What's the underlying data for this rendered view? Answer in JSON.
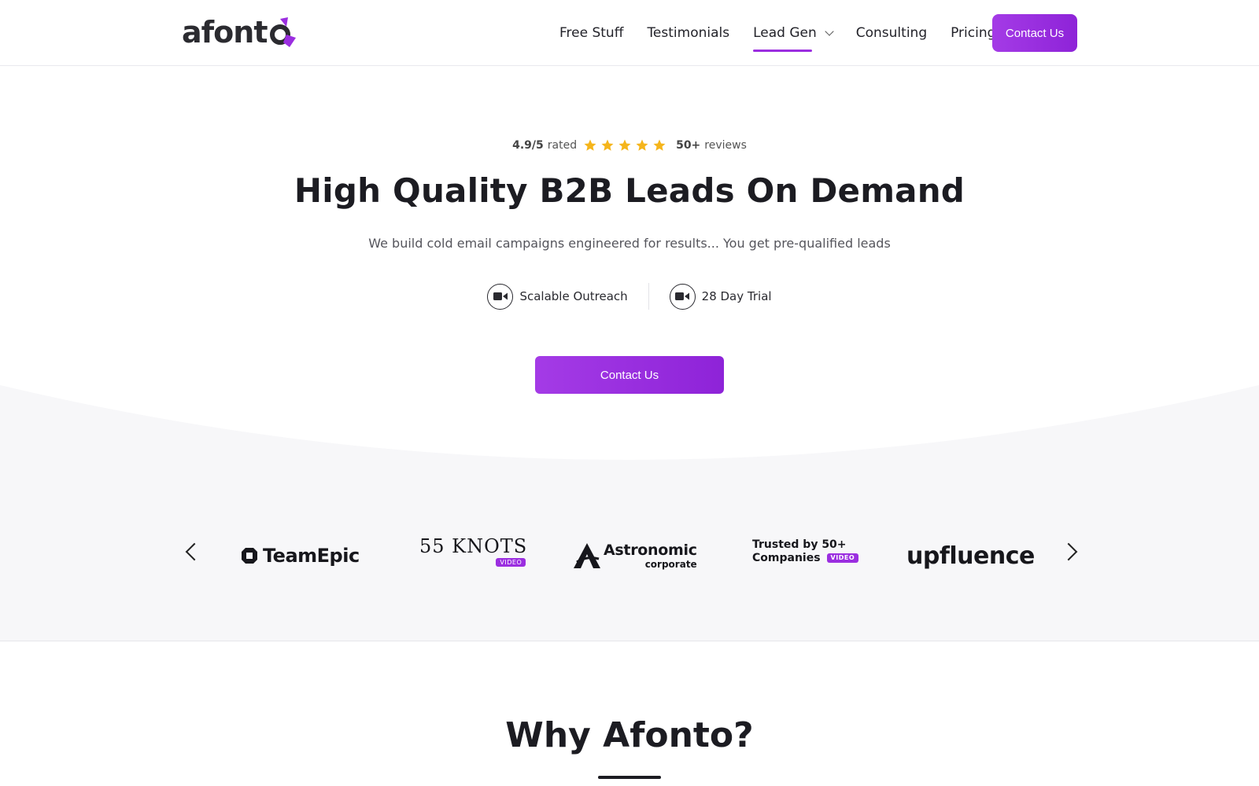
{
  "header": {
    "logo_text": "afont",
    "nav": [
      {
        "label": "Free Stuff"
      },
      {
        "label": "Testimonials"
      },
      {
        "label": "Lead Gen"
      },
      {
        "label": "Consulting"
      },
      {
        "label": "Pricing"
      }
    ],
    "cta_label": "Contact Us"
  },
  "hero": {
    "rating_score": "4.9/5",
    "rating_word": "rated",
    "stars": 5,
    "reviews_count": "50+",
    "reviews_word": "reviews",
    "title": "High Quality B2B Leads On Demand",
    "subtitle": "We build cold email campaigns engineered for results... You get pre-qualified leads",
    "features": [
      {
        "label": "Scalable Outreach"
      },
      {
        "label": "28 Day Trial"
      }
    ],
    "cta_label": "Contact Us"
  },
  "clients": {
    "teamepic": "TeamEpic",
    "knots": "55 KNOTS",
    "knots_badge": "VIDEO",
    "astro_main": "Astronomic",
    "astro_sub": "corporate",
    "trusted_line1": "Trusted by 50+",
    "trusted_line2": "Companies",
    "trusted_badge": "VIDEO",
    "upfluence": "upfluence"
  },
  "why": {
    "title": "Why Afonto?"
  },
  "colors": {
    "accent": "#9b2ee0",
    "accent_dark": "#8e23d8",
    "band_bg": "#f7f7f9",
    "star": "#f5b51b"
  }
}
